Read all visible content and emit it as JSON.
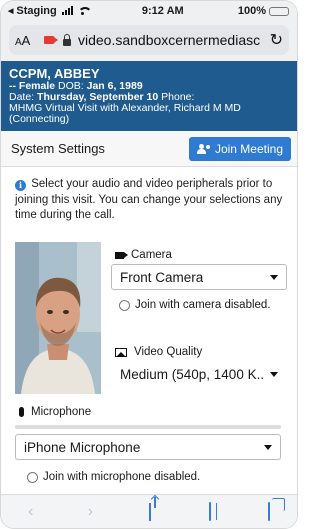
{
  "status_bar": {
    "back_app": "Staging",
    "time": "9:12 AM",
    "battery": "100%",
    "battery_level": 1.0
  },
  "browser": {
    "text_size_label": "AA",
    "url": "video.sandboxcernermediasc"
  },
  "patient": {
    "name": "CCPM, ABBEY",
    "gender_prefix": "-- Female",
    "dob_label": "DOB:",
    "dob": "Jan 6, 1989",
    "date_label": "Date:",
    "date": "Thursday, September 10",
    "phone_label": "Phone:",
    "visit_line": "MHMG Virtual Visit with Alexander, Richard M MD",
    "status": "(Connecting)"
  },
  "settings": {
    "title": "System Settings",
    "join_button": "Join Meeting",
    "info_text": "Select your audio and video peripherals prior to joining this visit. You can change your selections any time during the call."
  },
  "camera": {
    "label": "Camera",
    "selected": "Front Camera",
    "disable_label": "Join with camera disabled."
  },
  "video_quality": {
    "label": "Video Quality",
    "selected": "Medium (540p, 1400 K..."
  },
  "microphone": {
    "label": "Microphone",
    "selected": "iPhone Microphone",
    "disable_label": "Join with microphone disabled.",
    "level": 0.0
  },
  "colors": {
    "banner": "#1f5b8e",
    "accent": "#2e7bd1"
  },
  "icons": {
    "reload": "reload-icon",
    "share": "share-icon",
    "bookmarks": "book-icon",
    "tabs": "tabs-icon"
  }
}
